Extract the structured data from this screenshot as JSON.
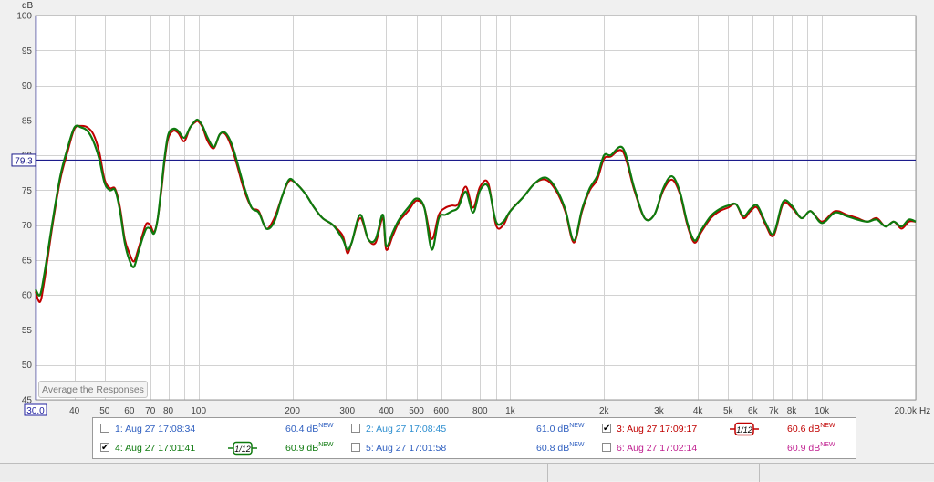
{
  "chart_data": {
    "type": "line",
    "y_unit": "dB",
    "x_unit": "Hz",
    "x_scale": "log",
    "xlim": [
      30,
      20000
    ],
    "ylim": [
      45,
      100
    ],
    "y_ticks": [
      100,
      95,
      90,
      85,
      80,
      75,
      70,
      65,
      60,
      55,
      50,
      45
    ],
    "x_tick_labels": [
      {
        "f": 30,
        "label": "30.0"
      },
      {
        "f": 40,
        "label": "40"
      },
      {
        "f": 50,
        "label": "50"
      },
      {
        "f": 60,
        "label": "60"
      },
      {
        "f": 70,
        "label": "70"
      },
      {
        "f": 80,
        "label": "80"
      },
      {
        "f": 100,
        "label": "100"
      },
      {
        "f": 200,
        "label": "200"
      },
      {
        "f": 300,
        "label": "300"
      },
      {
        "f": 400,
        "label": "400"
      },
      {
        "f": 500,
        "label": "500"
      },
      {
        "f": 600,
        "label": "600"
      },
      {
        "f": 800,
        "label": "800"
      },
      {
        "f": 1000,
        "label": "1k"
      },
      {
        "f": 2000,
        "label": "2k"
      },
      {
        "f": 3000,
        "label": "3k"
      },
      {
        "f": 4000,
        "label": "4k"
      },
      {
        "f": 5000,
        "label": "5k"
      },
      {
        "f": 6000,
        "label": "6k"
      },
      {
        "f": 7000,
        "label": "7k"
      },
      {
        "f": 8000,
        "label": "8k"
      },
      {
        "f": 10000,
        "label": "10k"
      },
      {
        "f": 20000,
        "label": "20.0k"
      }
    ],
    "x_end_unit_label": "Hz",
    "grid": true,
    "reference_line": {
      "value": 79.3,
      "label": "79.3",
      "color": "#1c1c8c"
    },
    "series": [
      {
        "name": "3: Aug 27 17:09:17",
        "color": "#c00000",
        "x": [
          30,
          31,
          32,
          34,
          36,
          38,
          40,
          42,
          44,
          46,
          48,
          50,
          52,
          54,
          56,
          58,
          60,
          62,
          64,
          66,
          68,
          70,
          72,
          74,
          76,
          78,
          80,
          83,
          86,
          90,
          94,
          98,
          100,
          103,
          107,
          112,
          117,
          122,
          128,
          134,
          140,
          148,
          156,
          165,
          175,
          185,
          195,
          205,
          220,
          235,
          250,
          270,
          290,
          300,
          310,
          330,
          350,
          370,
          390,
          400,
          420,
          440,
          470,
          500,
          530,
          560,
          590,
          620,
          650,
          680,
          720,
          760,
          800,
          850,
          900,
          950,
          1000,
          1100,
          1200,
          1300,
          1400,
          1500,
          1600,
          1700,
          1800,
          1900,
          2000,
          2100,
          2300,
          2500,
          2700,
          2900,
          3100,
          3300,
          3500,
          3700,
          3900,
          4100,
          4400,
          4700,
          5000,
          5300,
          5600,
          5900,
          6200,
          6600,
          7000,
          7500,
          8000,
          8600,
          9200,
          10000,
          11000,
          12000,
          13000,
          14000,
          15000,
          16000,
          17000,
          18000,
          19000,
          20000
        ],
        "y": [
          60.5,
          59.0,
          62.0,
          70.0,
          76.5,
          80.5,
          83.8,
          84.2,
          84.0,
          83.0,
          80.5,
          76.5,
          75.3,
          75.2,
          72.5,
          68.0,
          66.0,
          64.8,
          66.5,
          68.5,
          70.2,
          70.0,
          69.0,
          71.0,
          75.0,
          79.5,
          82.5,
          83.5,
          83.2,
          82.0,
          84.0,
          84.8,
          84.8,
          84.0,
          82.0,
          81.0,
          83.0,
          83.0,
          81.0,
          78.0,
          75.0,
          72.5,
          72.0,
          69.5,
          71.0,
          74.0,
          76.3,
          76.0,
          74.5,
          72.5,
          71.0,
          70.0,
          68.5,
          66.0,
          67.5,
          71.0,
          68.0,
          67.5,
          71.0,
          66.5,
          68.5,
          70.5,
          72.0,
          73.5,
          72.5,
          68.0,
          71.5,
          72.5,
          72.8,
          73.0,
          75.5,
          72.5,
          75.5,
          76.0,
          70.0,
          70.0,
          72.0,
          74.0,
          76.0,
          76.5,
          75.0,
          72.0,
          67.5,
          72.0,
          75.0,
          76.5,
          79.5,
          79.8,
          80.5,
          75.0,
          71.0,
          71.5,
          75.0,
          76.5,
          74.5,
          70.0,
          67.5,
          69.0,
          71.0,
          72.0,
          72.5,
          73.0,
          71.0,
          72.0,
          72.5,
          70.0,
          68.5,
          73.0,
          72.5,
          71.0,
          72.0,
          70.5,
          72.0,
          71.5,
          71.0,
          70.5,
          71.0,
          69.8,
          70.5,
          69.5,
          70.5,
          70.5
        ]
      },
      {
        "name": "4: Aug 27 17:01:41",
        "color": "#0e7a0e",
        "x": [
          30,
          31,
          32,
          34,
          36,
          38,
          40,
          42,
          44,
          46,
          48,
          50,
          52,
          54,
          56,
          58,
          60,
          62,
          64,
          66,
          68,
          70,
          72,
          74,
          76,
          78,
          80,
          83,
          86,
          90,
          94,
          98,
          100,
          103,
          107,
          112,
          117,
          122,
          128,
          134,
          140,
          148,
          156,
          165,
          175,
          185,
          195,
          205,
          220,
          235,
          250,
          270,
          290,
          300,
          310,
          330,
          350,
          370,
          390,
          400,
          420,
          440,
          470,
          500,
          530,
          560,
          590,
          620,
          650,
          680,
          720,
          760,
          800,
          850,
          900,
          950,
          1000,
          1100,
          1200,
          1300,
          1400,
          1500,
          1600,
          1700,
          1800,
          1900,
          2000,
          2100,
          2300,
          2500,
          2700,
          2900,
          3100,
          3300,
          3500,
          3700,
          3900,
          4100,
          4400,
          4700,
          5000,
          5300,
          5600,
          5900,
          6200,
          6600,
          7000,
          7500,
          8000,
          8600,
          9200,
          10000,
          11000,
          12000,
          13000,
          14000,
          15000,
          16000,
          17000,
          18000,
          19000,
          20000
        ],
        "y": [
          60.8,
          60.0,
          63.0,
          70.5,
          77.0,
          81.0,
          84.0,
          84.0,
          83.5,
          82.0,
          79.5,
          76.0,
          75.0,
          75.0,
          72.0,
          67.5,
          65.0,
          64.0,
          66.0,
          68.0,
          69.5,
          69.5,
          68.8,
          71.0,
          75.5,
          80.0,
          83.0,
          83.8,
          83.5,
          82.5,
          84.0,
          85.0,
          85.0,
          84.2,
          82.5,
          81.2,
          83.0,
          83.2,
          81.5,
          78.5,
          75.5,
          72.5,
          71.8,
          69.5,
          70.5,
          74.0,
          76.5,
          76.0,
          74.5,
          72.5,
          71.0,
          70.0,
          68.0,
          66.5,
          67.5,
          71.5,
          68.0,
          68.0,
          71.5,
          67.0,
          69.0,
          70.8,
          72.5,
          73.8,
          72.5,
          66.5,
          71.0,
          71.5,
          72.0,
          72.5,
          74.8,
          71.8,
          75.0,
          75.5,
          70.5,
          70.5,
          72.0,
          74.0,
          76.0,
          76.8,
          75.3,
          72.3,
          67.8,
          72.3,
          75.3,
          77.0,
          80.0,
          80.0,
          81.0,
          75.3,
          71.0,
          71.5,
          75.3,
          77.0,
          74.8,
          70.3,
          67.8,
          69.3,
          71.3,
          72.3,
          72.8,
          73.0,
          71.3,
          72.3,
          72.8,
          70.3,
          68.8,
          73.3,
          72.8,
          71.0,
          72.0,
          70.3,
          71.8,
          71.3,
          70.8,
          70.5,
          70.8,
          69.8,
          70.5,
          69.8,
          70.8,
          70.5
        ]
      }
    ]
  },
  "ui": {
    "avg_button_label": "Average the Responses"
  },
  "legend": {
    "items": [
      {
        "label": "1: Aug 27 17:08:34",
        "value": "60.4 dB",
        "sup": "NEW",
        "checked": false,
        "color": "#3060c0",
        "value_color": "#3060c0",
        "smoothing": ""
      },
      {
        "label": "2: Aug 27 17:08:45",
        "value": "61.0 dB",
        "sup": "NEW",
        "checked": false,
        "color": "#2f8fd0",
        "value_color": "#3060c0",
        "smoothing": ""
      },
      {
        "label": "3: Aug 27 17:09:17",
        "value": "60.6 dB",
        "sup": "NEW",
        "checked": true,
        "color": "#c00000",
        "value_color": "#c00000",
        "smoothing": "1/12"
      },
      {
        "label": "4: Aug 27 17:01:41",
        "value": "60.9 dB",
        "sup": "NEW",
        "checked": true,
        "color": "#0e7a0e",
        "value_color": "#0e7a0e",
        "smoothing": "1/12"
      },
      {
        "label": "5: Aug 27 17:01:58",
        "value": "60.8 dB",
        "sup": "NEW",
        "checked": false,
        "color": "#3060c0",
        "value_color": "#3060c0",
        "smoothing": ""
      },
      {
        "label": "6: Aug 27 17:02:14",
        "value": "60.9 dB",
        "sup": "NEW",
        "checked": false,
        "color": "#c02090",
        "value_color": "#c02090",
        "smoothing": ""
      }
    ]
  }
}
